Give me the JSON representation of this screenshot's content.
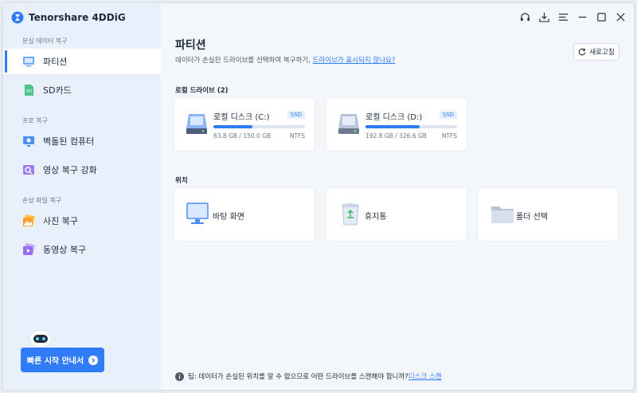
{
  "app": {
    "title": "Tenorshare 4DDiG"
  },
  "sidebar": {
    "sections": [
      {
        "label": "분실 데이터 복구"
      },
      {
        "label": "프로 복구"
      },
      {
        "label": "손상 파일 복구"
      }
    ],
    "items": [
      {
        "label": "파티션"
      },
      {
        "label": "SD카드"
      },
      {
        "label": "벽돌된 컴퓨터"
      },
      {
        "label": "영상 복구 강화"
      },
      {
        "label": "사진 복구"
      },
      {
        "label": "동영상 복구"
      }
    ],
    "quick_start_label": "빠른 시작 안내서"
  },
  "main": {
    "title": "파티션",
    "subtitle": "데이터가 손실된 드라이브를 선택하여 복구하기,",
    "subtitle_link": "드라이브가 표시되지 않나요?",
    "refresh_label": "새로고침",
    "local_drives_label": "로컬 드라이브 (2)",
    "drives": [
      {
        "name": "로컬 디스크 (C:)",
        "badge": "SSD",
        "size": "63.8 GB / 150.0 GB",
        "fs": "NTFS",
        "used_fraction": 0.425
      },
      {
        "name": "로컬 디스크 (D:)",
        "badge": "SSD",
        "size": "192.8 GB / 326.6 GB",
        "fs": "NTFS",
        "used_fraction": 0.59
      }
    ],
    "location_label": "위치",
    "locations": [
      {
        "label": "바탕 화면"
      },
      {
        "label": "휴지통"
      },
      {
        "label": "폴더 선택"
      }
    ],
    "tip_text": "팁: 데이터가 손실된 위치를 알 수 없으므로 어떤 드라이브를 스캔해야 합니까?",
    "tip_link": "디스크 스캔"
  },
  "colors": {
    "accent": "#2f7cf6",
    "sidebar_bg": "#e7f0fb",
    "main_bg": "#f3f6fa"
  },
  "icons": [
    "headset-icon",
    "download-icon",
    "menu-icon",
    "minimize-icon",
    "maximize-icon",
    "close-icon"
  ]
}
